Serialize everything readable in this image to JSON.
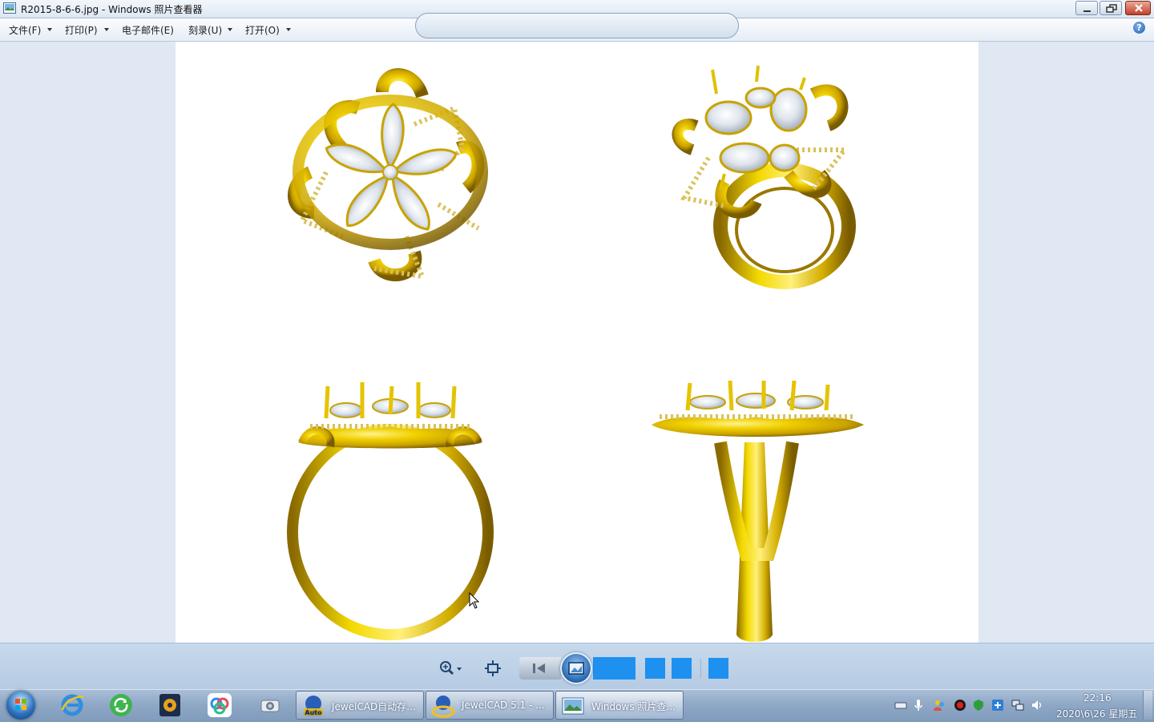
{
  "window": {
    "title": "R2015-8-6-6.jpg - Windows 照片查看器",
    "icon": "photo-viewer-icon",
    "buttons": [
      "minimize-icon",
      "restore-icon",
      "close-icon"
    ]
  },
  "menu": {
    "items": [
      {
        "label": "文件(F)",
        "has_dropdown": true
      },
      {
        "label": "打印(P)",
        "has_dropdown": true
      },
      {
        "label": "电子邮件(E)",
        "has_dropdown": false
      },
      {
        "label": "刻录(U)",
        "has_dropdown": true
      },
      {
        "label": "打开(O)",
        "has_dropdown": true
      }
    ],
    "help": "?"
  },
  "image": {
    "subject": "gold flower ring with pear-cut diamonds, four views",
    "colors": {
      "gold": "#e6c300",
      "gold_dark": "#8a6a00",
      "stone": "#e4e9ef",
      "background": "#ffffff"
    }
  },
  "controls": {
    "icons": [
      "zoom-icon",
      "fit-window-icon",
      "previous-icon",
      "slideshow-icon",
      "next-icon",
      "rotate-left-icon",
      "rotate-right-icon",
      "delete-icon"
    ],
    "accent": "#1e90f0"
  },
  "taskbar": {
    "pinned": [
      "start-orb",
      "internet-explorer-icon",
      "green-refresh-app-icon",
      "media-player-icon",
      "cloud-app-icon",
      "scanner-app-icon"
    ],
    "tasks": [
      {
        "label": "JewelCAD自动存...",
        "icon": "jewelcad-auto-icon",
        "active": false
      },
      {
        "label": "JewelCAD 5.1 - ...",
        "icon": "jewelcad-icon",
        "active": false
      },
      {
        "label": "Windows 照片查...",
        "icon": "photo-viewer-icon",
        "active": true
      }
    ],
    "tray": [
      "keyboard-icon",
      "microphone-icon",
      "people-icon",
      "record-icon",
      "security-icon",
      "network-app-icon",
      "network-icon",
      "volume-icon"
    ],
    "clock": {
      "time": "22:16",
      "date": "2020\\6\\26 星期五"
    }
  }
}
